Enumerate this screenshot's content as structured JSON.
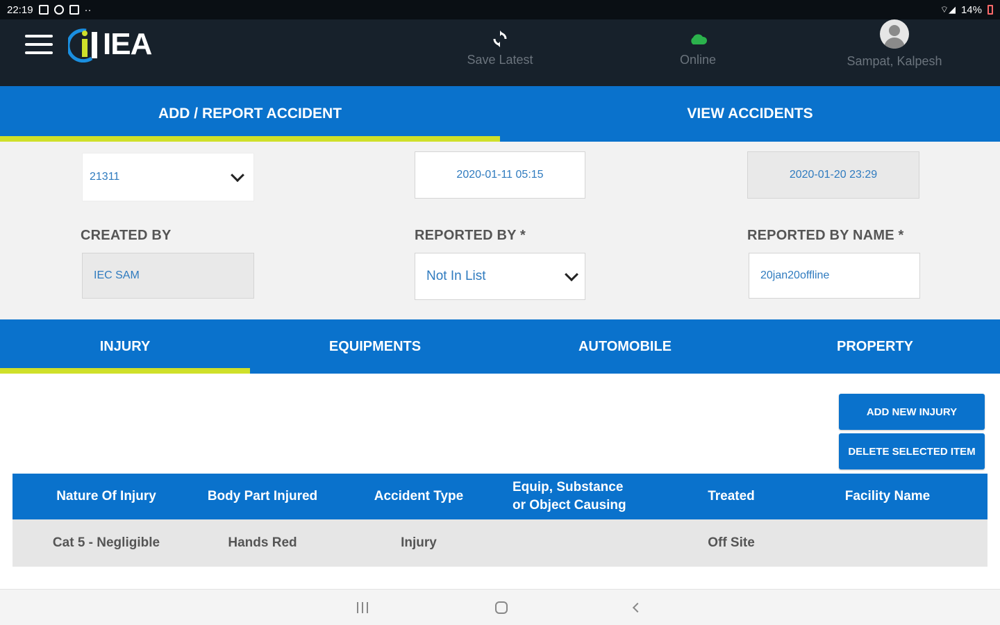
{
  "statusbar": {
    "time": "22:19",
    "notif_more": "··",
    "battery": "14%"
  },
  "header": {
    "logo_text": "IEA",
    "save_latest_label": "Save Latest",
    "online_label": "Online",
    "user_name": "Sampat, Kalpesh"
  },
  "main_tabs": [
    {
      "label": "ADD / REPORT ACCIDENT",
      "active": true
    },
    {
      "label": "VIEW ACCIDENTS",
      "active": false
    }
  ],
  "form": {
    "id_select_value": "21311",
    "accident_datetime": "2020-01-11 05:15",
    "report_datetime": "2020-01-20 23:29",
    "created_by_label": "CREATED BY",
    "created_by_value": "IEC SAM",
    "reported_by_label": "REPORTED BY *",
    "reported_by_value": "Not In List",
    "reported_by_name_label": "REPORTED BY NAME *",
    "reported_by_name_value": "20jan20offline"
  },
  "section_tabs": [
    {
      "label": "INJURY",
      "active": true
    },
    {
      "label": "EQUIPMENTS",
      "active": false
    },
    {
      "label": "AUTOMOBILE",
      "active": false
    },
    {
      "label": "PROPERTY",
      "active": false
    }
  ],
  "buttons": {
    "add_new_injury": "ADD NEW INJURY",
    "delete_selected": "DELETE SELECTED ITEM"
  },
  "table": {
    "headers": [
      "Nature Of Injury",
      "Body Part Injured",
      "Accident Type",
      "Equip, Substance or Object Causing",
      "Treated",
      "Facility Name"
    ],
    "rows": [
      [
        "Cat 5 - Negligible",
        "Hands Red",
        "Injury",
        "",
        "Off Site",
        ""
      ]
    ]
  },
  "colors": {
    "primary": "#0a72cc",
    "accent": "#cfe02a",
    "header_bg": "#17212b",
    "online": "#2bb24c"
  }
}
